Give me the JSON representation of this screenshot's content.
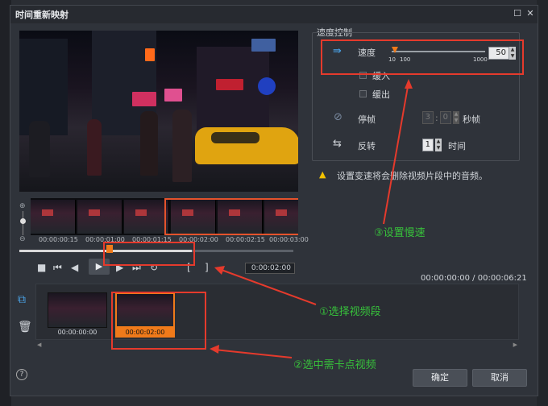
{
  "dialog": {
    "title": "时间重新映射"
  },
  "speed_control": {
    "group_title": "速度控制",
    "speed_label": "速度",
    "speed_value": "50",
    "slider_min_label": "10",
    "slider_mid_label": "100",
    "slider_max_label": "1000",
    "ease_in_label": "缓入",
    "ease_out_label": "缓出",
    "freeze_label": "停帧",
    "freeze_seconds": "3",
    "freeze_frames": "0",
    "freeze_unit": "秒帧",
    "reverse_label": "反转",
    "reverse_value": "1",
    "reverse_unit": "时间"
  },
  "warning": {
    "text": "设置变速将会删除视频片段中的音频。"
  },
  "timeline": {
    "timecodes": [
      "00:00:00:15",
      "00:00:01:00",
      "00:00:01:15",
      "00:00:02:00",
      "00:00:02:15",
      "00:00:03:00"
    ],
    "current_time": "0:00:02:00",
    "total_time": "00:00:00:00 / 00:00:06:21"
  },
  "clips": [
    {
      "label": "00:00:00:00"
    },
    {
      "label": "00:00:02:00"
    }
  ],
  "annotations": {
    "step1": "①选择视频段",
    "step2": "②选中需卡点视频",
    "step3": "③设置慢速"
  },
  "buttons": {
    "ok": "确定",
    "cancel": "取消"
  },
  "icons": {
    "help": "?",
    "maximize": "☐",
    "close": "✕"
  },
  "colors": {
    "annotation_red": "#e53a2c",
    "annotation_green": "#37c23b",
    "accent_orange": "#f07a1a"
  }
}
